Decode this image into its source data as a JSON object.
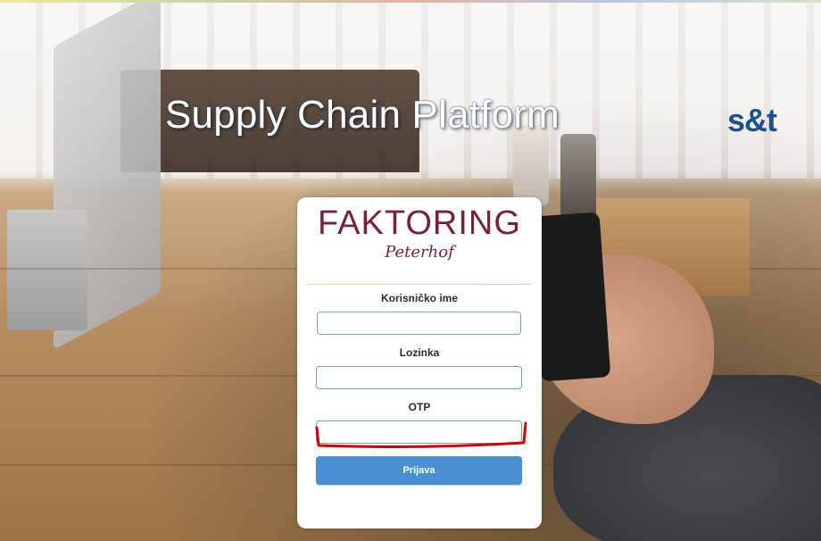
{
  "header": {
    "title": "Supply Chain Platform",
    "brand": "s&t"
  },
  "logo": {
    "main": "FAKTORING",
    "sub": "Peterhof"
  },
  "form": {
    "username_label": "Korisničko ime",
    "username_value": "",
    "password_label": "Lozinka",
    "password_value": "",
    "otp_label": "OTP",
    "otp_value": "",
    "submit_label": "Prijava"
  },
  "colors": {
    "button": "#4a8fd1",
    "logo": "#7a1f3d",
    "brand": "#1d4f91",
    "otp_highlight": "#d40000"
  }
}
